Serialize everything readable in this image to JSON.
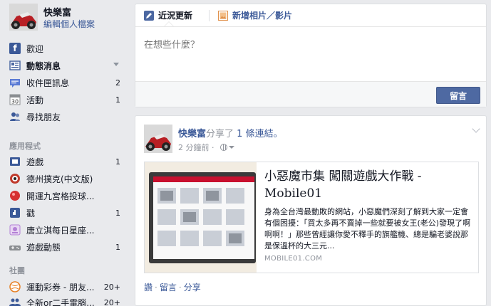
{
  "sidebar": {
    "profile_name": "快樂富",
    "profile_edit": "編輯個人檔案",
    "favorites": [
      {
        "label": "歡迎",
        "count": "",
        "icon": "facebook-icon",
        "color": "#3b5998"
      },
      {
        "label": "動態消息",
        "count": "",
        "icon": "news-feed-icon",
        "color": "#4b67a1"
      },
      {
        "label": "收件匣訊息",
        "count": "2",
        "icon": "messages-icon",
        "color": "#5b7bd5"
      },
      {
        "label": "活動",
        "count": "1",
        "icon": "calendar-icon",
        "color": "#8a8d91"
      },
      {
        "label": "尋找朋友",
        "count": "",
        "icon": "find-friends-icon",
        "color": "#3b5998"
      }
    ],
    "apps_header": "應用程式",
    "apps": [
      {
        "label": "遊戲",
        "count": "1",
        "icon": "games-icon",
        "color": "#3b5998"
      },
      {
        "label": "德州撲克(中文版)",
        "count": "",
        "icon": "poker-icon",
        "color": "#c0392b"
      },
      {
        "label": "開運九宮格投球...",
        "count": "",
        "icon": "lucky-ball-icon",
        "color": "#d63031"
      },
      {
        "label": "戳",
        "count": "1",
        "icon": "poke-icon",
        "color": "#3b5998"
      },
      {
        "label": "唐立淇每日星座...",
        "count": "",
        "icon": "horoscope-icon",
        "color": "#b380d6"
      },
      {
        "label": "遊戲動態",
        "count": "1",
        "icon": "game-feed-icon",
        "color": "#8a8d91"
      }
    ],
    "groups_header": "社團",
    "groups": [
      {
        "label": "運動彩券 - 朋友...",
        "count": "20+",
        "icon": "sports-ball-icon",
        "color": "#e67e22"
      },
      {
        "label": "全新or二手電腦...",
        "count": "20+",
        "icon": "group-icon",
        "color": "#3b5998"
      }
    ]
  },
  "composer": {
    "tab_status": "近況更新",
    "tab_photo": "新增相片／影片",
    "placeholder": "在想些什麼？",
    "post_button": "留言"
  },
  "story": {
    "author": "快樂富",
    "verb": "分享了",
    "link_count": "1 條連結。",
    "time": "2 分鐘前 ·",
    "link_title": "小惡魔市集 闖關遊戲大作戰 - Mobile01",
    "link_desc": "身為全台灣最動敗的網站，小惡魔們深刻了解到大家一定會有個困擾：「買太多再不賣掉一些就要被女王(老公)發現了啊啊啊！」那些曾經讓你愛不釋手的旗艦機、總是騙老婆說那是保溫杯的大三元...",
    "link_domain": "MOBILE01.COM",
    "action_like": "讚",
    "action_comment": "留言",
    "action_share": "分享"
  },
  "colors": {
    "link_blue": "#3b5998",
    "button_blue": "#4e69a2",
    "background": "#e9eaed",
    "muted": "#90949c"
  }
}
